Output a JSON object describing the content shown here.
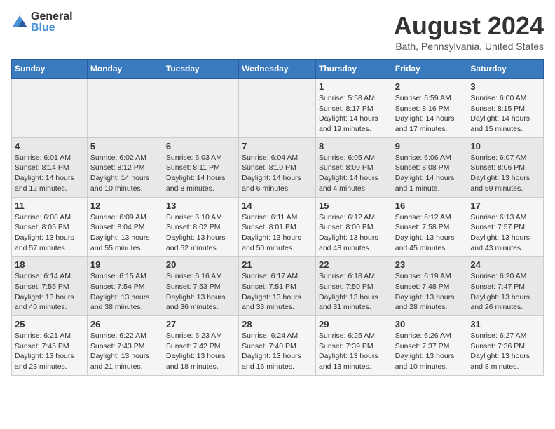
{
  "logo": {
    "general": "General",
    "blue": "Blue"
  },
  "title": "August 2024",
  "location": "Bath, Pennsylvania, United States",
  "days_header": [
    "Sunday",
    "Monday",
    "Tuesday",
    "Wednesday",
    "Thursday",
    "Friday",
    "Saturday"
  ],
  "weeks": [
    [
      {
        "day": "",
        "info": ""
      },
      {
        "day": "",
        "info": ""
      },
      {
        "day": "",
        "info": ""
      },
      {
        "day": "",
        "info": ""
      },
      {
        "day": "1",
        "info": "Sunrise: 5:58 AM\nSunset: 8:17 PM\nDaylight: 14 hours\nand 19 minutes."
      },
      {
        "day": "2",
        "info": "Sunrise: 5:59 AM\nSunset: 8:16 PM\nDaylight: 14 hours\nand 17 minutes."
      },
      {
        "day": "3",
        "info": "Sunrise: 6:00 AM\nSunset: 8:15 PM\nDaylight: 14 hours\nand 15 minutes."
      }
    ],
    [
      {
        "day": "4",
        "info": "Sunrise: 6:01 AM\nSunset: 8:14 PM\nDaylight: 14 hours\nand 12 minutes."
      },
      {
        "day": "5",
        "info": "Sunrise: 6:02 AM\nSunset: 8:12 PM\nDaylight: 14 hours\nand 10 minutes."
      },
      {
        "day": "6",
        "info": "Sunrise: 6:03 AM\nSunset: 8:11 PM\nDaylight: 14 hours\nand 8 minutes."
      },
      {
        "day": "7",
        "info": "Sunrise: 6:04 AM\nSunset: 8:10 PM\nDaylight: 14 hours\nand 6 minutes."
      },
      {
        "day": "8",
        "info": "Sunrise: 6:05 AM\nSunset: 8:09 PM\nDaylight: 14 hours\nand 4 minutes."
      },
      {
        "day": "9",
        "info": "Sunrise: 6:06 AM\nSunset: 8:08 PM\nDaylight: 14 hours\nand 1 minute."
      },
      {
        "day": "10",
        "info": "Sunrise: 6:07 AM\nSunset: 8:06 PM\nDaylight: 13 hours\nand 59 minutes."
      }
    ],
    [
      {
        "day": "11",
        "info": "Sunrise: 6:08 AM\nSunset: 8:05 PM\nDaylight: 13 hours\nand 57 minutes."
      },
      {
        "day": "12",
        "info": "Sunrise: 6:09 AM\nSunset: 8:04 PM\nDaylight: 13 hours\nand 55 minutes."
      },
      {
        "day": "13",
        "info": "Sunrise: 6:10 AM\nSunset: 8:02 PM\nDaylight: 13 hours\nand 52 minutes."
      },
      {
        "day": "14",
        "info": "Sunrise: 6:11 AM\nSunset: 8:01 PM\nDaylight: 13 hours\nand 50 minutes."
      },
      {
        "day": "15",
        "info": "Sunrise: 6:12 AM\nSunset: 8:00 PM\nDaylight: 13 hours\nand 48 minutes."
      },
      {
        "day": "16",
        "info": "Sunrise: 6:12 AM\nSunset: 7:58 PM\nDaylight: 13 hours\nand 45 minutes."
      },
      {
        "day": "17",
        "info": "Sunrise: 6:13 AM\nSunset: 7:57 PM\nDaylight: 13 hours\nand 43 minutes."
      }
    ],
    [
      {
        "day": "18",
        "info": "Sunrise: 6:14 AM\nSunset: 7:55 PM\nDaylight: 13 hours\nand 40 minutes."
      },
      {
        "day": "19",
        "info": "Sunrise: 6:15 AM\nSunset: 7:54 PM\nDaylight: 13 hours\nand 38 minutes."
      },
      {
        "day": "20",
        "info": "Sunrise: 6:16 AM\nSunset: 7:53 PM\nDaylight: 13 hours\nand 36 minutes."
      },
      {
        "day": "21",
        "info": "Sunrise: 6:17 AM\nSunset: 7:51 PM\nDaylight: 13 hours\nand 33 minutes."
      },
      {
        "day": "22",
        "info": "Sunrise: 6:18 AM\nSunset: 7:50 PM\nDaylight: 13 hours\nand 31 minutes."
      },
      {
        "day": "23",
        "info": "Sunrise: 6:19 AM\nSunset: 7:48 PM\nDaylight: 13 hours\nand 28 minutes."
      },
      {
        "day": "24",
        "info": "Sunrise: 6:20 AM\nSunset: 7:47 PM\nDaylight: 13 hours\nand 26 minutes."
      }
    ],
    [
      {
        "day": "25",
        "info": "Sunrise: 6:21 AM\nSunset: 7:45 PM\nDaylight: 13 hours\nand 23 minutes."
      },
      {
        "day": "26",
        "info": "Sunrise: 6:22 AM\nSunset: 7:43 PM\nDaylight: 13 hours\nand 21 minutes."
      },
      {
        "day": "27",
        "info": "Sunrise: 6:23 AM\nSunset: 7:42 PM\nDaylight: 13 hours\nand 18 minutes."
      },
      {
        "day": "28",
        "info": "Sunrise: 6:24 AM\nSunset: 7:40 PM\nDaylight: 13 hours\nand 16 minutes."
      },
      {
        "day": "29",
        "info": "Sunrise: 6:25 AM\nSunset: 7:39 PM\nDaylight: 13 hours\nand 13 minutes."
      },
      {
        "day": "30",
        "info": "Sunrise: 6:26 AM\nSunset: 7:37 PM\nDaylight: 13 hours\nand 10 minutes."
      },
      {
        "day": "31",
        "info": "Sunrise: 6:27 AM\nSunset: 7:36 PM\nDaylight: 13 hours\nand 8 minutes."
      }
    ]
  ]
}
